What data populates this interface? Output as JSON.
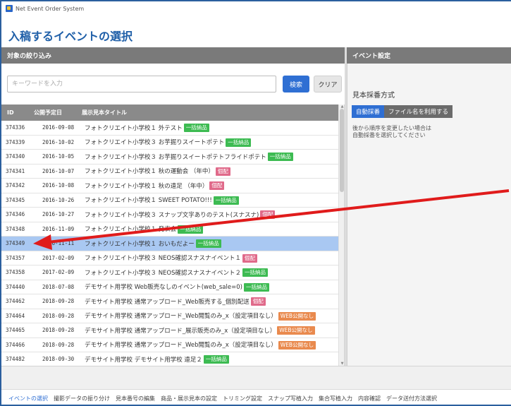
{
  "window": {
    "title": "Net Event Order System"
  },
  "page": {
    "title": "入稿するイベントの選択"
  },
  "filter_panel": {
    "header": "対象の絞り込み"
  },
  "settings_panel": {
    "header": "イベント設定"
  },
  "search": {
    "placeholder": "キーワードを入力",
    "search_label": "検索",
    "clear_label": "クリア"
  },
  "table": {
    "columns": [
      "ID",
      "公開予定日",
      "展示見本タイトル"
    ],
    "rows": [
      {
        "id": "374336",
        "date": "2016-09-08",
        "title": "フォトクリエイト小学校１ 外テスト",
        "badge": "一括納品"
      },
      {
        "id": "374339",
        "date": "2016-10-02",
        "title": "フォトクリエイト小学校３ お芋掘りスイートポテト",
        "badge": "一括納品"
      },
      {
        "id": "374340",
        "date": "2016-10-05",
        "title": "フォトクリエイト小学校３ お芋掘りスイートポテトフライドポテト",
        "badge": "一括納品"
      },
      {
        "id": "374341",
        "date": "2016-10-07",
        "title": "フォトクリエイト小学校１ 秋の運動会 （年中）",
        "badge": "個配"
      },
      {
        "id": "374342",
        "date": "2016-10-08",
        "title": "フォトクリエイト小学校１ 秋の遠足 （年中）",
        "badge": "個配"
      },
      {
        "id": "374345",
        "date": "2016-10-26",
        "title": "フォトクリエイト小学校１ SWEET POTATO!!!",
        "badge": "一括納品"
      },
      {
        "id": "374346",
        "date": "2016-10-27",
        "title": "フォトクリエイト小学校３ スナップ文字ありのテスト(スナスナ)",
        "badge": "個配"
      },
      {
        "id": "374348",
        "date": "2016-11-09",
        "title": "フォトクリエイト小学校１ 発表会",
        "badge": "一括納品"
      },
      {
        "id": "374349",
        "date": "2016-11-11",
        "title": "フォトクリエイト小学校１ おいもだよー",
        "badge": "一括納品"
      },
      {
        "id": "374357",
        "date": "2017-02-09",
        "title": "フォトクリエイト小学校３ NEOS確認スナスナイベント１",
        "badge": "個配"
      },
      {
        "id": "374358",
        "date": "2017-02-09",
        "title": "フォトクリエイト小学校３ NEOS確認スナスナイベント２",
        "badge": "一括納品"
      },
      {
        "id": "374440",
        "date": "2018-07-08",
        "title": "デモサイト用学校 Web販売なしのイベント(web_sale=0)",
        "badge": "一括納品"
      },
      {
        "id": "374462",
        "date": "2018-09-28",
        "title": "デモサイト用学校 通常アップロード_Web販売する_個別配送",
        "badge": "個配"
      },
      {
        "id": "374464",
        "date": "2018-09-28",
        "title": "デモサイト用学校 通常アップロード_Web閲覧のみ_x（設定項目なし）",
        "badge": "WEB公開なし"
      },
      {
        "id": "374465",
        "date": "2018-09-28",
        "title": "デモサイト用学校 通常アップロード_展示販売のみ_x（設定項目なし）",
        "badge": "WEB公開なし"
      },
      {
        "id": "374466",
        "date": "2018-09-28",
        "title": "デモサイト用学校 通常アップロード_Web閲覧のみ_x（設定項目なし）",
        "badge": "WEB公開なし"
      },
      {
        "id": "374482",
        "date": "2018-09-30",
        "title": "デモサイト用学校 デモサイト用学校 遠足２",
        "badge": "一括納品"
      }
    ],
    "selected_id": "374349"
  },
  "numbering": {
    "label": "見本採番方式",
    "auto_label": "自動採番",
    "filename_label": "ファイル名を利用する",
    "help": "後から順序を変更したい場合は\n自動採番を選択してください"
  },
  "bottom_nav": {
    "items": [
      "イベントの選択",
      "撮影データの振り分け",
      "見本番号の編集",
      "商品・展示見本の設定",
      "トリミング設定",
      "スナップ写植入力",
      "集合写植入力",
      "内容確認",
      "データ送付方法選択"
    ],
    "active_index": 0
  },
  "badge_colors": {
    "一括納品": "#3dbb52",
    "個配": "#e06a8a",
    "WEB公開なし": "#e98a4e"
  },
  "colors": {
    "accent": "#2f6fd3",
    "title": "#1f5fa8",
    "selected_row": "#a9c8f2",
    "annotation_arrow": "#e01b1b"
  }
}
